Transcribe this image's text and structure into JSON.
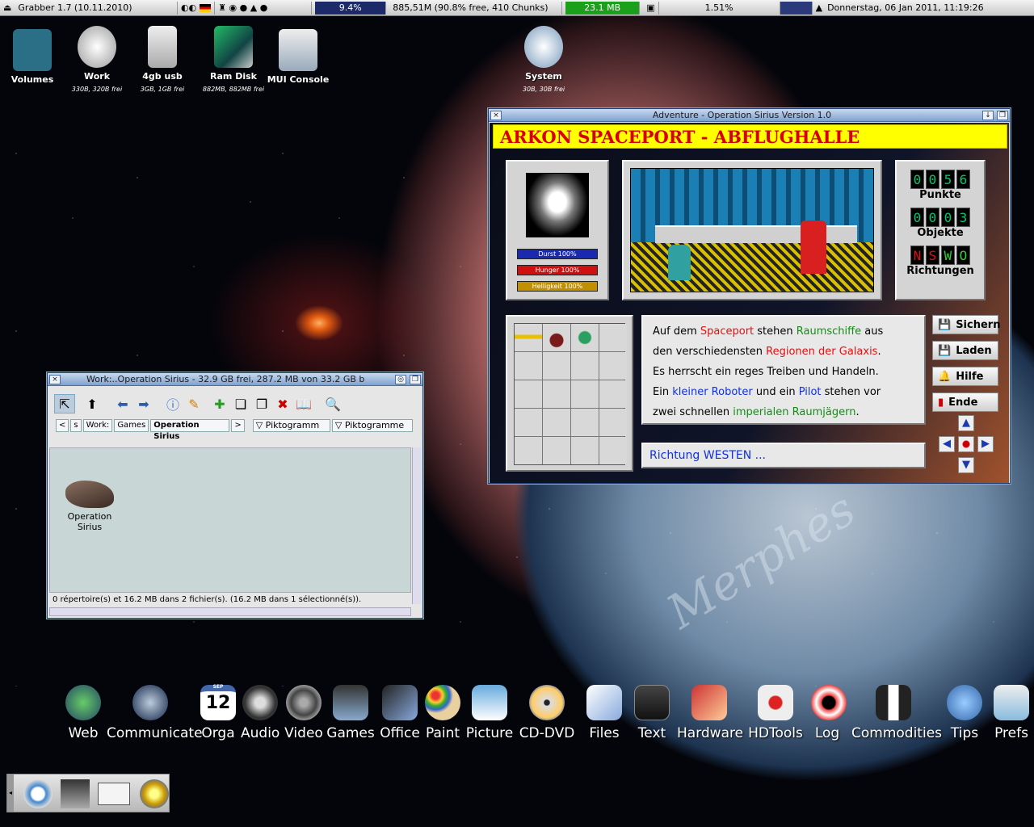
{
  "topbar": {
    "app": "Grabber 1.7 (10.11.2010)",
    "cpu": "9.4%",
    "disk": "885,51M (90.8% free, 410 Chunks)",
    "mem": "23.1 MB",
    "net": "1.51%",
    "datetime": "Donnerstag, 06 Jan 2011, 11:19:26"
  },
  "desktop_icons": [
    {
      "label": "Volumes",
      "sub": ""
    },
    {
      "label": "Work",
      "sub": "330B, 320B frei"
    },
    {
      "label": "4gb usb",
      "sub": "3GB, 1GB frei"
    },
    {
      "label": "Ram Disk",
      "sub": "882MB, 882MB frei"
    },
    {
      "label": "MUI Console",
      "sub": ""
    },
    {
      "label": "System",
      "sub": "30B, 30B frei"
    }
  ],
  "adventure": {
    "title": "Adventure - Operation Sirius Version 1.0",
    "location": "ARKON SPACEPORT - ABFLUGHALLE",
    "bars": [
      {
        "label": "Durst 100%",
        "value": 100,
        "color": "#1a2ab0"
      },
      {
        "label": "Hunger 100%",
        "value": 100,
        "color": "#d01010"
      },
      {
        "label": "Helligkeit 100%",
        "value": 100,
        "color": "#c09000"
      }
    ],
    "punkte": [
      "0",
      "0",
      "5",
      "6"
    ],
    "punkte_label": "Punkte",
    "objekte": [
      "0",
      "0",
      "0",
      "3"
    ],
    "objekte_label": "Objekte",
    "richtungen": [
      "N",
      "S",
      "W",
      "O"
    ],
    "richtungen_label": "Richtungen",
    "text": [
      [
        [
          "Auf dem ",
          "#000"
        ],
        [
          "Spaceport",
          "#e01010"
        ],
        [
          " stehen ",
          "#000"
        ],
        [
          "Raumschiffe",
          "#109010"
        ],
        [
          " aus",
          "#000"
        ]
      ],
      [
        [
          "den verschiedensten ",
          "#000"
        ],
        [
          "Regionen der Galaxis",
          "#e01010"
        ],
        [
          ".",
          "#000"
        ]
      ],
      [
        [
          "Es herrscht ein reges Treiben und Handeln.",
          "#000"
        ]
      ],
      [
        [
          "Ein ",
          "#000"
        ],
        [
          "kleiner Roboter",
          "#1030e0"
        ],
        [
          " und ein ",
          "#000"
        ],
        [
          "Pilot",
          "#1030e0"
        ],
        [
          " stehen vor",
          "#000"
        ]
      ],
      [
        [
          "zwei schnellen ",
          "#000"
        ],
        [
          "imperialen Raumjägern",
          "#109010"
        ],
        [
          ".",
          "#000"
        ]
      ]
    ],
    "input": "Richtung WESTEN ...",
    "buttons": [
      "Sichern",
      "Laden",
      "Hilfe",
      "Ende"
    ]
  },
  "work_window": {
    "title": "Work:..Operation Sirius - 32.9 GB frei, 287.2 MB von 33.2 GB b",
    "crumbs": [
      "<",
      "s",
      "Work:",
      "Games",
      "Operation Sirius",
      ">"
    ],
    "view1": "Piktogramm",
    "view2": "Piktogramme",
    "item_line1": "Operation",
    "item_line2": "Sirius",
    "status": "0 répertoire(s) et 16.2 MB dans 2 fichier(s). (16.2 MB dans 1 sélectionné(s))."
  },
  "wallpaper_text": "Merphes",
  "dock": [
    "Web",
    "Communicate",
    "Orga",
    "Audio",
    "Video",
    "Games",
    "Office",
    "Paint",
    "Picture",
    "CD-DVD",
    "Files",
    "Text",
    "Hardware",
    "HDTools",
    "Log",
    "Commodities",
    "Tips",
    "Prefs"
  ],
  "orga_date": {
    "month": "SEP",
    "day": "12"
  },
  "colors": {
    "location_bg": "#ffff00",
    "location_text": "#d60000",
    "digit": "#00c870"
  }
}
